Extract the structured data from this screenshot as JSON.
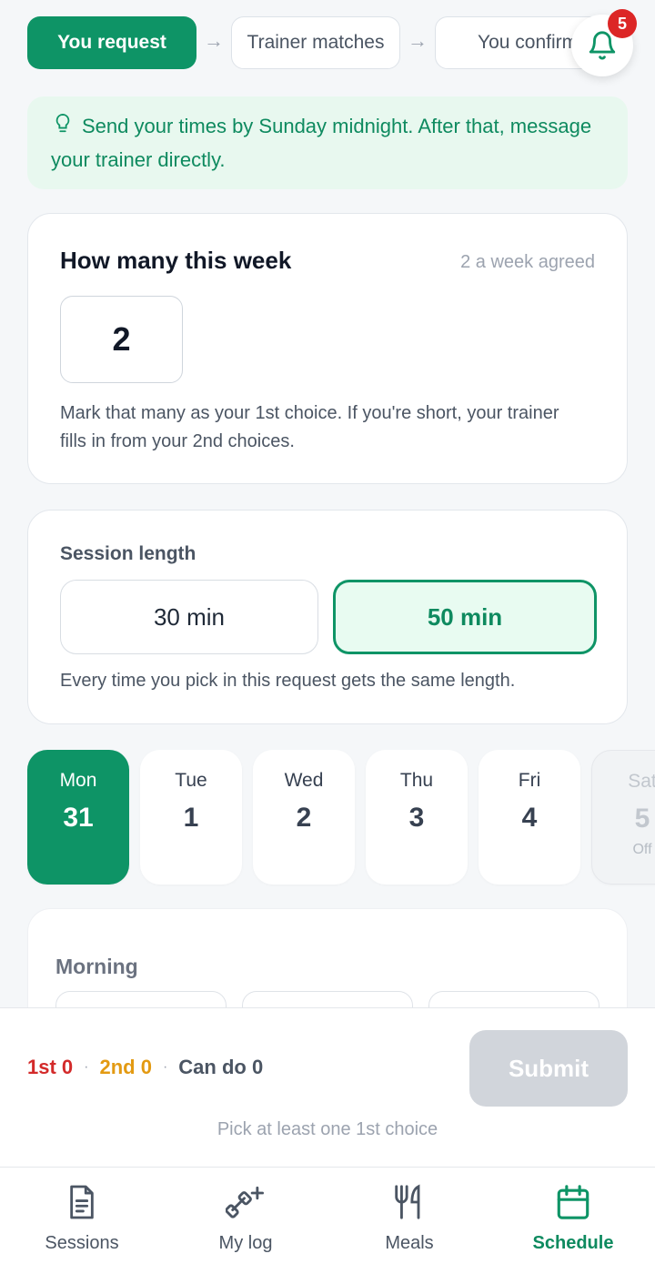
{
  "steps": [
    {
      "label": "You request",
      "state": "active"
    },
    {
      "label": "Trainer matches",
      "state": "inactive"
    },
    {
      "label": "You confirm",
      "state": "inactive"
    }
  ],
  "notifications": {
    "icon": "bell-icon",
    "count": "5"
  },
  "tip": {
    "icon": "lightbulb-icon",
    "text": "Send your times by Sunday midnight. After that, message your trainer directly."
  },
  "weekly": {
    "title": "How many this week",
    "agreed": "2 a week agreed",
    "count": "2",
    "help": "Mark that many as your 1st choice. If you're short, your trainer fills in from your 2nd choices."
  },
  "session_length": {
    "label": "Session length",
    "options": [
      {
        "label": "30 min",
        "selected": false
      },
      {
        "label": "50 min",
        "selected": true
      }
    ],
    "help": "Every time you pick in this request gets the same length."
  },
  "days": [
    {
      "name": "Mon",
      "date": "31",
      "state": "selected"
    },
    {
      "name": "Tue",
      "date": "1",
      "state": "normal"
    },
    {
      "name": "Wed",
      "date": "2",
      "state": "normal"
    },
    {
      "name": "Thu",
      "date": "3",
      "state": "normal"
    },
    {
      "name": "Fri",
      "date": "4",
      "state": "normal"
    },
    {
      "name": "Sat",
      "date": "5",
      "state": "off",
      "note": "Off"
    }
  ],
  "times": {
    "section_label": "Morning"
  },
  "summary": {
    "first": "1st 0",
    "second": "2nd 0",
    "can_do": "Can do 0",
    "submit_label": "Submit",
    "hint": "Pick at least one 1st choice"
  },
  "colors": {
    "accent": "#0e9466",
    "first": "#d32a2a",
    "second": "#e39a12"
  },
  "tabs": [
    {
      "label": "Sessions",
      "icon": "document-icon",
      "active": false
    },
    {
      "label": "My log",
      "icon": "dumbbell-plus-icon",
      "active": false
    },
    {
      "label": "Meals",
      "icon": "fork-knife-icon",
      "active": false
    },
    {
      "label": "Schedule",
      "icon": "calendar-icon",
      "active": true
    }
  ]
}
